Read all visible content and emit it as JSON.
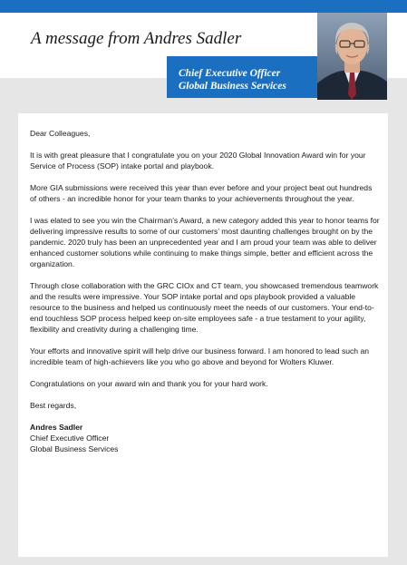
{
  "header": {
    "title": "A message from Andres Sadler",
    "role_line1": "Chief Executive Officer",
    "role_line2": "Global Business Services"
  },
  "letter": {
    "salutation": "Dear Colleagues,",
    "paragraphs": [
      "It is with great pleasure that I congratulate you on your 2020 Global Innovation Award win for your Service of Process (SOP) intake portal and playbook.",
      "More GIA submissions were received this year than ever before and your project beat out hundreds of others - an incredible honor for your team thanks to your achievements throughout the year.",
      "I was elated to see you win the Chairman’s Award, a new category added this year to honor teams for delivering impressive results to some of our customers’ most daunting challenges brought on by the pandemic.  2020 truly has been an unprecedented year and I am proud your team was able to deliver enhanced customer solutions while continuing to make things simple, better and efficient across the organization.",
      "Through close collaboration with the GRC CIOx and CT team, you showcased tremendous teamwork and the results were impressive.   Your SOP intake portal and ops playbook provided a valuable resource to the business and helped us continuously meet the needs of our customers.  Your end-to-end touchless SOP process helped keep on-site employees safe - a true testament to your agility, flexibility and creativity during a challenging time.",
      "Your efforts and innovative spirit will help drive our business forward. I am honored to lead such an incredible team of high-achievers like you who go above and beyond for Wolters Kluwer.",
      "Congratulations on your award win and thank you for your hard work."
    ],
    "closing": "Best regards,",
    "signature": {
      "name": "Andres Sadler",
      "title": "Chief Executive Officer",
      "org": "Global Business Services"
    }
  },
  "colors": {
    "accent": "#1b6fc0",
    "background": "#e6e6e6"
  }
}
